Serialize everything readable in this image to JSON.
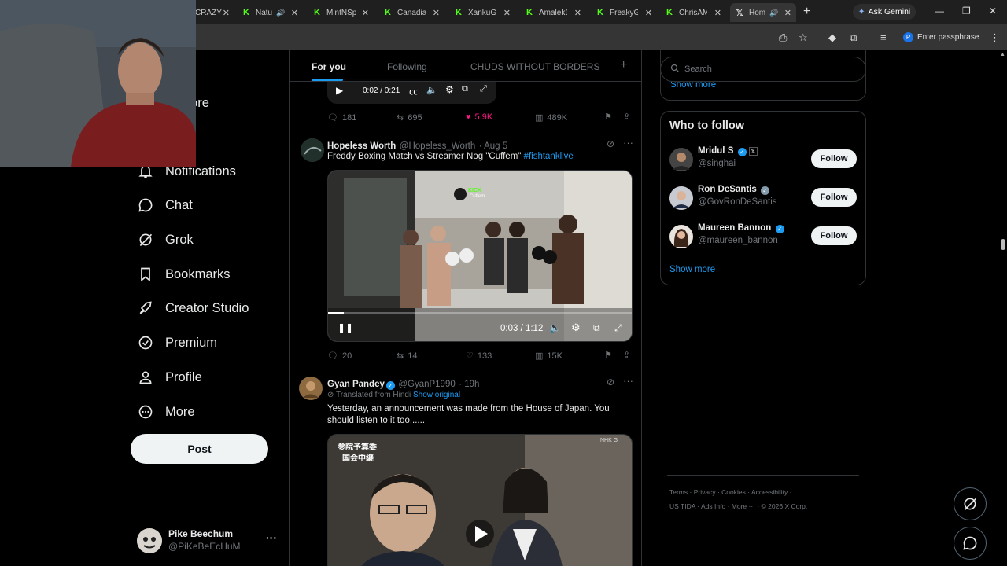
{
  "browser": {
    "tabs": [
      {
        "title": "CRAZYTA",
        "favicon": "kick-icon"
      },
      {
        "title": "Natu",
        "favicon": "kick-icon"
      },
      {
        "title": "MintNSp",
        "favicon": "kick-icon"
      },
      {
        "title": "Canadian",
        "favicon": "kick-icon"
      },
      {
        "title": "XankuGa",
        "favicon": "kick-icon"
      },
      {
        "title": "Amalek1",
        "favicon": "kick-icon"
      },
      {
        "title": "FreakyG",
        "favicon": "kick-icon"
      },
      {
        "title": "ChrisAM",
        "favicon": "kick-icon"
      },
      {
        "title": "Hom",
        "favicon": "x-icon"
      }
    ],
    "gemini_label": "Ask Gemini",
    "passphrase_label": "Enter passphrase",
    "profile_initial": "P"
  },
  "nav": {
    "items": [
      {
        "label": "Explore"
      },
      {
        "label": "Notifications"
      },
      {
        "label": "Chat"
      },
      {
        "label": "Grok"
      },
      {
        "label": "Bookmarks"
      },
      {
        "label": "Creator Studio"
      },
      {
        "label": "Premium"
      },
      {
        "label": "Profile"
      },
      {
        "label": "More"
      }
    ],
    "post_label": "Post",
    "account": {
      "name": "Pike Beechum",
      "handle": "@PiKeBeEcHuM"
    }
  },
  "timeline": {
    "tabs": [
      "For you",
      "Following",
      "CHUDS WITHOUT BORDERS"
    ],
    "tweet0": {
      "video_time": "0:02 / 0:21",
      "replies": "181",
      "reposts": "695",
      "likes": "5.9K",
      "views": "489K"
    },
    "tweet1": {
      "name": "Hopeless Worth",
      "handle": "@Hopeless_Worth",
      "date": "· Aug 5",
      "text": "Freddy Boxing Match vs Streamer Nog \"Cuffem\" ",
      "hashtag": "#fishtanklive",
      "video_time": "0:03 / 1:12",
      "overlay_name": "Cuffem",
      "replies": "20",
      "reposts": "14",
      "likes": "133",
      "views": "15K"
    },
    "tweet2": {
      "name": "Gyan Pandey",
      "handle": "@GyanP1990",
      "date": "· 19h",
      "translated": "Translated from Hindi",
      "show_original": "Show original",
      "text_line1": "Yesterday, an announcement was made from the House of Japan. You",
      "text_line2": "should listen to it too......",
      "caption_line1": "参院予算委",
      "caption_line2": "国会中継",
      "network": "NHK G"
    }
  },
  "sidebar": {
    "search_placeholder": "Search",
    "show_more_top": "Show more",
    "who_to_follow_title": "Who to follow",
    "follow_suggestions": [
      {
        "name": "Mridul S",
        "handle": "@singhai",
        "button": "Follow"
      },
      {
        "name": "Ron DeSantis",
        "handle": "@GovRonDeSantis",
        "button": "Follow"
      },
      {
        "name": "Maureen Bannon",
        "handle": "@maureen_bannon",
        "button": "Follow"
      }
    ],
    "show_more": "Show more",
    "footer_line1": [
      "Terms",
      "Privacy",
      "Cookies",
      "Accessibility"
    ],
    "footer_line2": [
      "US TIDA",
      "Ads Info",
      "More ···",
      "© 2026 X Corp."
    ]
  },
  "colors": {
    "accent": "#1d9bf0",
    "like": "#f91880",
    "kick": "#53fc18"
  }
}
